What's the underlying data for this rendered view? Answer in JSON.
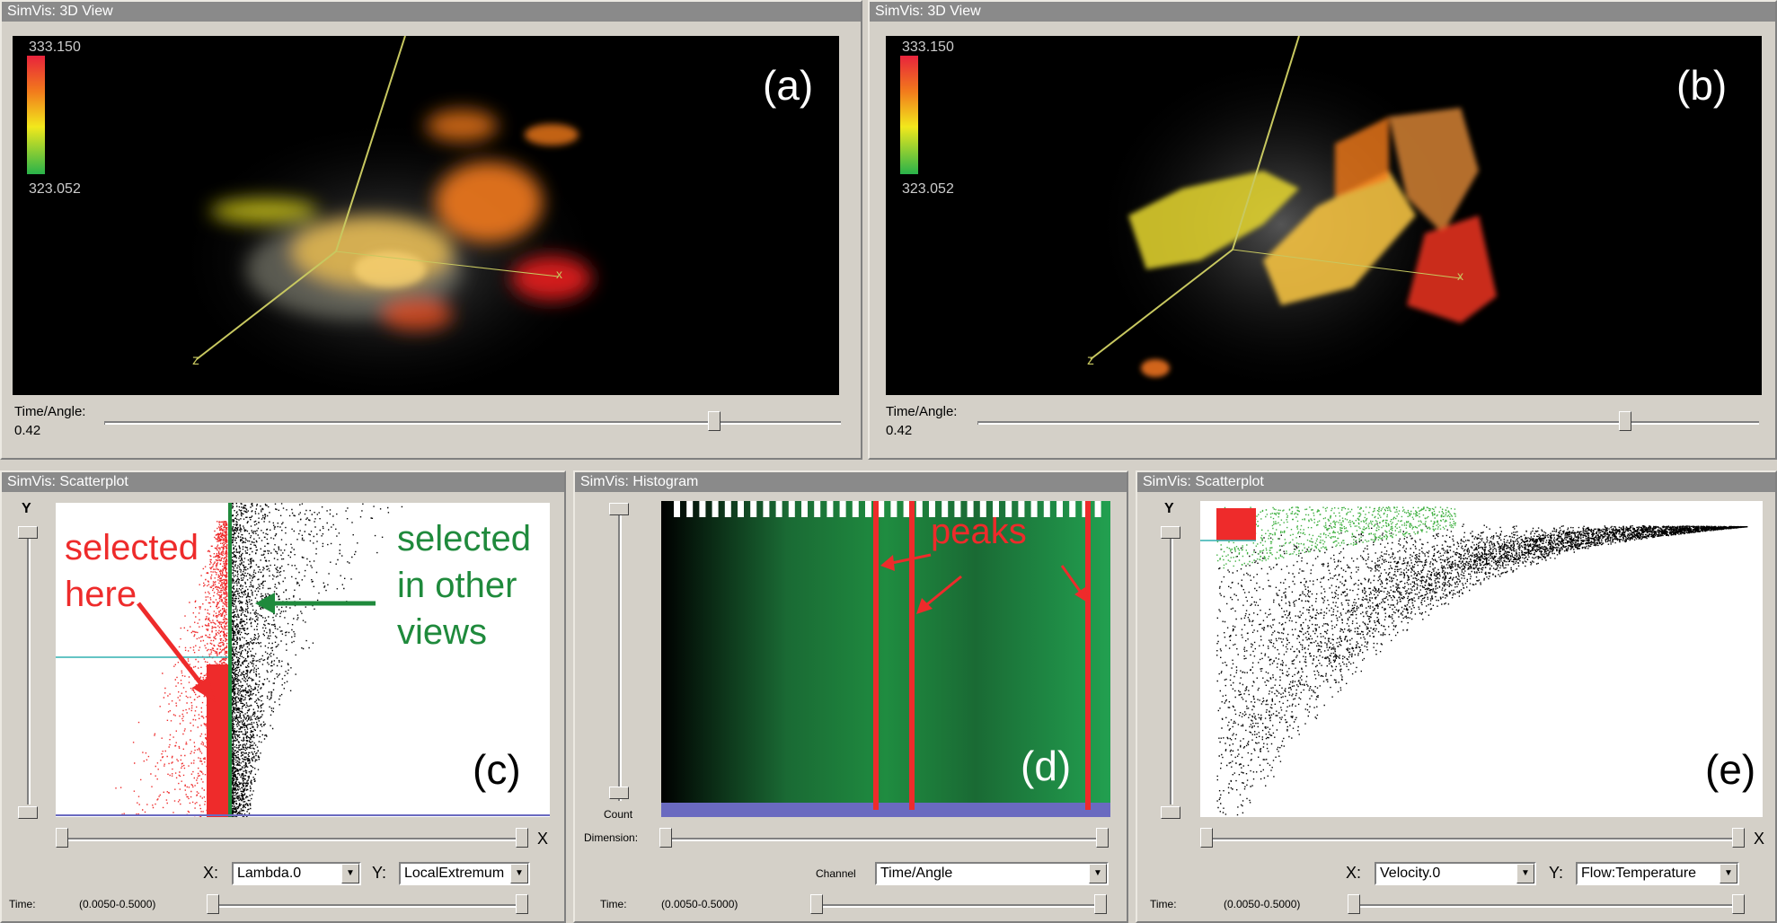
{
  "views3d": [
    {
      "title": "SimVis: 3D View",
      "max": "333.150",
      "min": "323.052",
      "letter": "(a)",
      "axis_z": "z",
      "axis_x": "x",
      "slider_label": "Time/Angle:",
      "slider_value": "0.42",
      "slider_fraction": 0.74
    },
    {
      "title": "SimVis: 3D View",
      "max": "333.150",
      "min": "323.052",
      "letter": "(b)",
      "axis_z": "z",
      "axis_x": "x",
      "slider_label": "Time/Angle:",
      "slider_value": "0.42",
      "slider_fraction": 0.74
    }
  ],
  "scatter_c": {
    "title": "SimVis: Scatterplot",
    "y_label": "Y",
    "letter": "(c)",
    "annot_red": [
      "selected",
      "here"
    ],
    "annot_green": [
      "selected",
      "in other",
      "views"
    ],
    "x_axis_label": "X:",
    "x_value": "Lambda.0",
    "y_axis_label": "Y:",
    "y_value": "LocalExtremum",
    "close": "X",
    "time_label": "Time:",
    "time_range": "(0.0050-0.5000)"
  },
  "histogram_d": {
    "title": "SimVis: Histogram",
    "letter": "(d)",
    "annot": "peaks",
    "count_label": "Count",
    "dimension_label": "Dimension:",
    "channel_label": "Channel",
    "channel_value": "Time/Angle",
    "time_label": "Time:",
    "time_range": "(0.0050-0.5000)"
  },
  "scatter_e": {
    "title": "SimVis: Scatterplot",
    "y_label": "Y",
    "letter": "(e)",
    "x_axis_label": "X:",
    "x_value": "Velocity.0",
    "y_axis_label": "Y:",
    "y_value": "Flow:Temperature",
    "close": "X",
    "time_label": "Time:",
    "time_range": "(0.0050-0.5000)"
  },
  "colors": {
    "titlebar": "#8a8a8a",
    "red": "#ee2b2b",
    "green": "#1f8a3c",
    "baseline": "#6a6ac0"
  }
}
